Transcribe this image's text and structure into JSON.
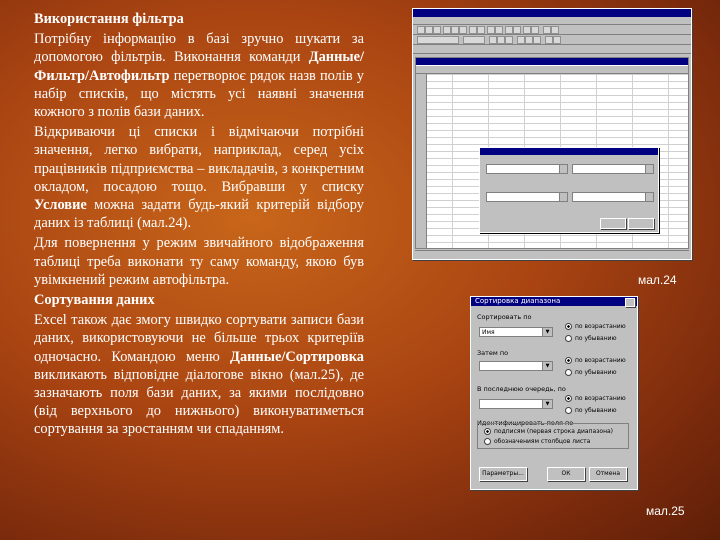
{
  "text": {
    "heading1": "Використання фільтра",
    "p1": "Потрібну інформацію в базі зручно шукати за допомогою фільтрів. Виконання команди ",
    "p1_bold": "Данные/Фильтр/Автофильтр",
    "p1_end": " перетворює рядок назв полів у набір списків, що містять усі наявні значення кожного з полів бази даних.",
    "p2": "Відкриваючи ці списки і відмічаючи потрібні значення, легко вибрати, наприклад, серед усіх працівників підприємства – викладачів, з конкретним окладом, посадою тощо. Вибравши у списку ",
    "p2_bold": "Условие",
    "p2_end": " можна задати будь-який критерій відбору даних із таблиці (мал.24).",
    "p3": "Для повернення у режим звичайного відображення таблиці треба виконати ту саму команду, якою був увімкнений режим автофільтра.",
    "heading2": "Сортування даних",
    "p4": "Excel також дає змогу швидко сортувати записи бази даних, використовуючи не більше трьох критеріїв одночасно. Командою меню ",
    "p4_bold": "Данные/Сортировка",
    "p4_end": " викликають відповідне діалогове вікно (мал.25), де зазначають поля бази даних, за якими послідовно (від верхнього до нижнього) виконуватиметься сортування за зростанням чи спаданням."
  },
  "captions": {
    "fig24": "мал.24",
    "fig25": "мал.25"
  },
  "sort_dialog": {
    "title": "Сортировка диапазона",
    "sort_by_label": "Сортировать по",
    "then_by_label": "Затем по",
    "last_by_label": "В последнюю очередь, по",
    "first_value": "Имя",
    "ascending": "по возрастанию",
    "descending": "по убыванию",
    "header_group_label": "Идентифицировать поля по",
    "header_option1": "подписям (первая строка диапазона)",
    "header_option2": "обозначениям столбцов листа",
    "params_button": "Параметры...",
    "ok_button": "ОК",
    "cancel_button": "Отмена"
  },
  "colors": {
    "background": "#a94412",
    "dialog_title": "#000080",
    "dialog_face": "#c0c0c0"
  }
}
